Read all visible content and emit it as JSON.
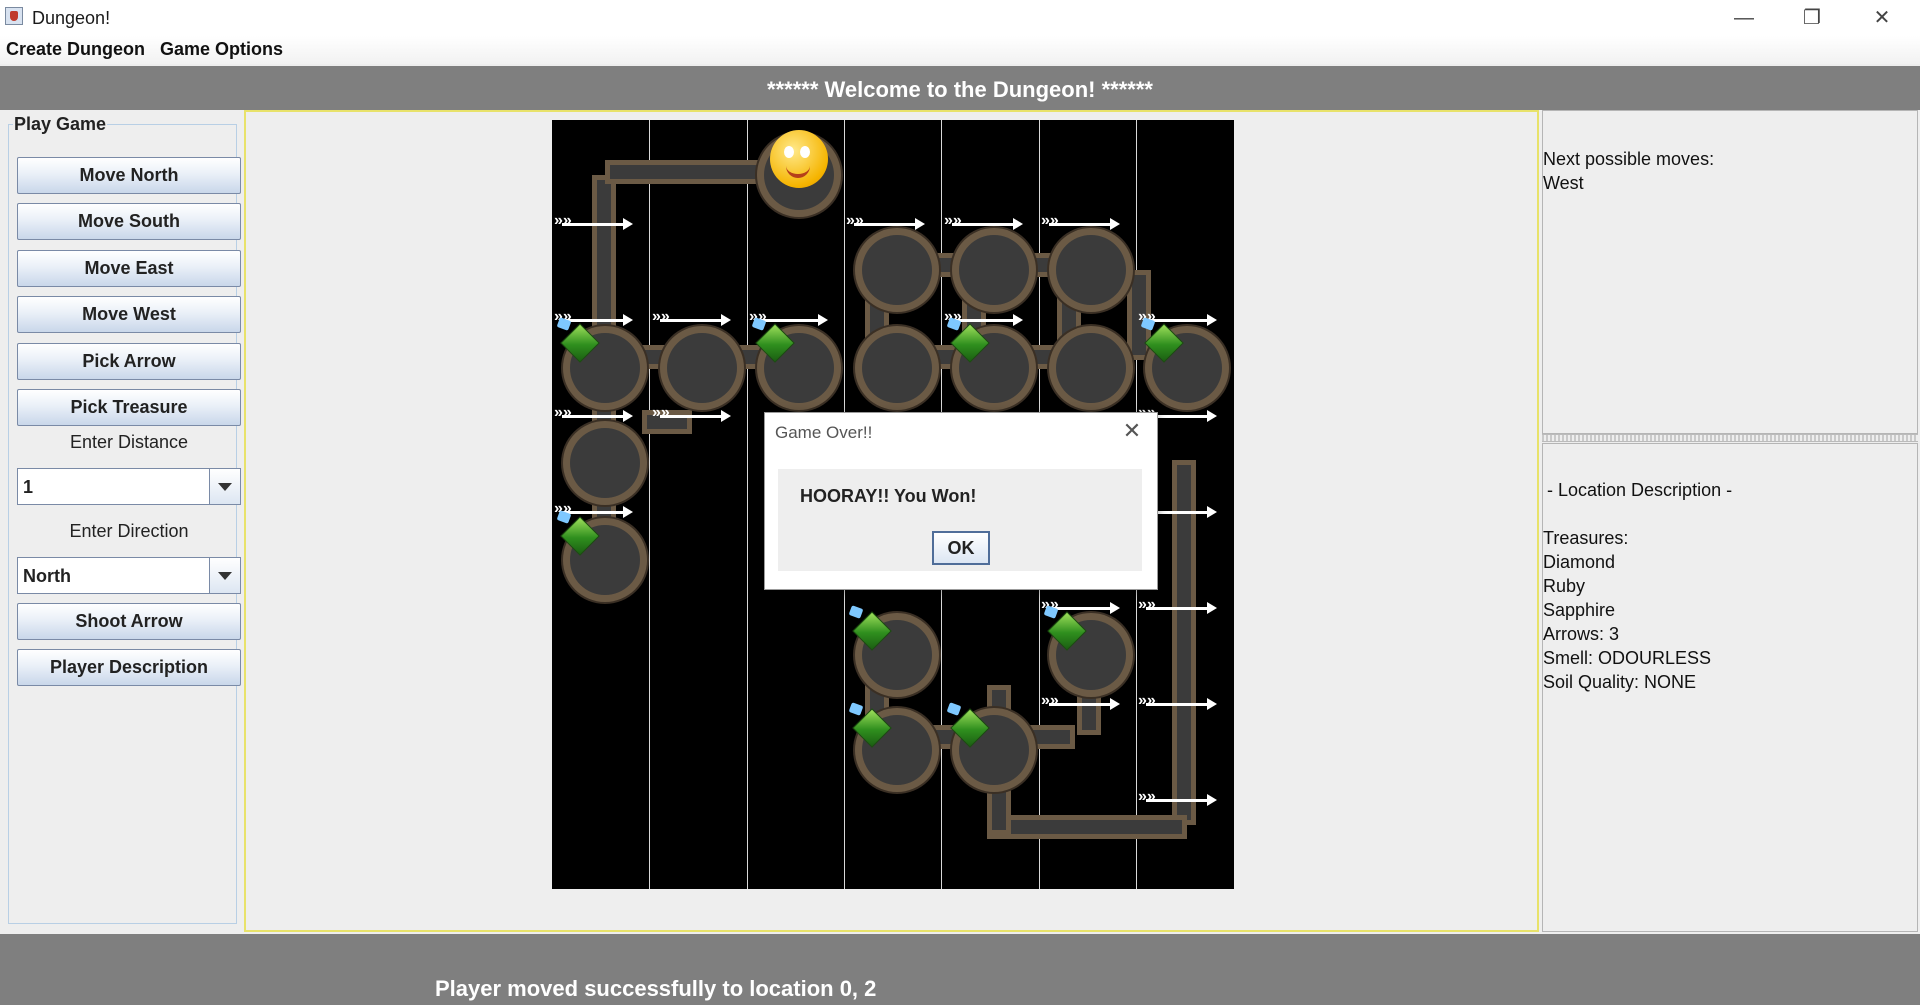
{
  "window": {
    "title": "Dungeon!",
    "minimize": "—",
    "maximize": "❐",
    "close": "✕"
  },
  "menu": {
    "items": [
      "Create Dungeon",
      "Game Options"
    ]
  },
  "header": {
    "text": "****** Welcome to the Dungeon! ******"
  },
  "left": {
    "group_label": "Play Game",
    "buttons": {
      "move_north": "Move North",
      "move_south": "Move South",
      "move_east": "Move East",
      "move_west": "Move West",
      "pick_arrow": "Pick Arrow",
      "pick_treasure": "Pick Treasure",
      "shoot_arrow": "Shoot Arrow",
      "player_description": "Player Description"
    },
    "distance_label": "Enter Distance",
    "distance_value": "1",
    "direction_label": "Enter Direction",
    "direction_value": "North"
  },
  "dialog": {
    "title": "Game Over!!",
    "message": "HOORAY!! You Won!",
    "ok": "OK",
    "close": "✕"
  },
  "right": {
    "moves_title": "Next possible moves:",
    "moves": [
      "West"
    ],
    "location_title": "- Location Description -",
    "treasures_title": "Treasures:",
    "treasures": [
      "Diamond",
      "Ruby",
      "Sapphire"
    ],
    "arrows": "Arrows: 3",
    "smell": "Smell: ODOURLESS",
    "soil": "Soil Quality: NONE"
  },
  "footer": {
    "status": "Player moved successfully to location 0, 2"
  },
  "colors": {
    "header_bg": "#7f7f7f",
    "board_bg": "#000000",
    "center_border": "#e8e26a"
  }
}
